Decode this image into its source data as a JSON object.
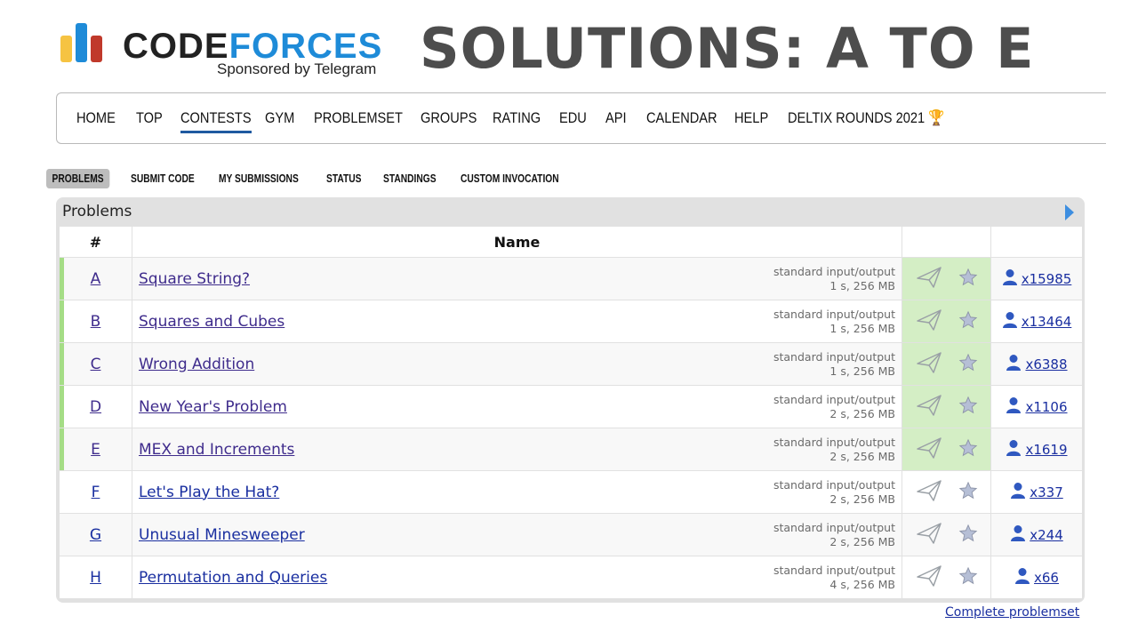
{
  "brand": {
    "name_part1": "CODE",
    "name_part2": "FORCES",
    "sponsor": "Sponsored by Telegram"
  },
  "headline": "SOLUTIONS: A TO E",
  "top_nav": {
    "items": [
      "HOME",
      "TOP",
      "CONTESTS",
      "GYM",
      "PROBLEMSET",
      "GROUPS",
      "RATING",
      "EDU",
      "API",
      "CALENDAR",
      "HELP",
      "DELTIX ROUNDS 2021"
    ],
    "active": "CONTESTS",
    "trophy_icon": "trophy-icon"
  },
  "second_menu": {
    "items": [
      "PROBLEMS",
      "SUBMIT CODE",
      "MY SUBMISSIONS",
      "STATUS",
      "STANDINGS",
      "CUSTOM INVOCATION"
    ],
    "active": "PROBLEMS"
  },
  "problems_box": {
    "title": "Problems",
    "columns": [
      "#",
      "Name",
      "",
      ""
    ],
    "rows": [
      {
        "index": "A",
        "name": "Square String?",
        "io": "standard input/output",
        "limits": "1 s, 256 MB",
        "solved_count": "x15985",
        "solved": true
      },
      {
        "index": "B",
        "name": "Squares and Cubes",
        "io": "standard input/output",
        "limits": "1 s, 256 MB",
        "solved_count": "x13464",
        "solved": true
      },
      {
        "index": "C",
        "name": "Wrong Addition",
        "io": "standard input/output",
        "limits": "1 s, 256 MB",
        "solved_count": "x6388",
        "solved": true
      },
      {
        "index": "D",
        "name": "New Year's Problem",
        "io": "standard input/output",
        "limits": "2 s, 256 MB",
        "solved_count": "x1106",
        "solved": true
      },
      {
        "index": "E",
        "name": "MEX and Increments",
        "io": "standard input/output",
        "limits": "2 s, 256 MB",
        "solved_count": "x1619",
        "solved": true
      },
      {
        "index": "F",
        "name": "Let's Play the Hat?",
        "io": "standard input/output",
        "limits": "2 s, 256 MB",
        "solved_count": "x337",
        "solved": false
      },
      {
        "index": "G",
        "name": "Unusual Minesweeper",
        "io": "standard input/output",
        "limits": "2 s, 256 MB",
        "solved_count": "x244",
        "solved": false
      },
      {
        "index": "H",
        "name": "Permutation and Queries",
        "io": "standard input/output",
        "limits": "4 s, 256 MB",
        "solved_count": "x66",
        "solved": false
      }
    ],
    "complete_link": "Complete problemset"
  },
  "colors": {
    "solved_bg": "#d4eec5",
    "solved_bar": "#a5dd86",
    "link": "#1a2fa0",
    "visited_link": "#3f2c8c",
    "headline": "#4d4d4d"
  }
}
